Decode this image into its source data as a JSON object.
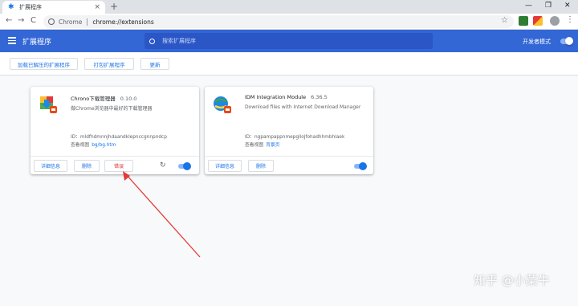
{
  "browser": {
    "tab_title": "扩展程序",
    "tab_close": "×",
    "new_tab": "+",
    "window_controls": [
      "—",
      "❐",
      "✕"
    ],
    "nav": [
      "←",
      "→",
      "C"
    ],
    "url_scheme": "Chrome",
    "url": "chrome://extensions",
    "bookmark_icon": "star-icon",
    "menu": "⋮"
  },
  "header": {
    "title": "扩展程序",
    "search_placeholder": "搜索扩展程序",
    "dev_mode_label": "开发者模式",
    "dev_mode_on": true
  },
  "actions": {
    "load_unpacked": "加载已解压的扩展程序",
    "pack": "打包扩展程序",
    "update": "更新"
  },
  "extensions": [
    {
      "name": "Chrono下载管理器",
      "version": "0.10.0",
      "description": "做Chrome浏览器中最好的下载管理器",
      "id_line": "ID：mldfhdmnnjhdaandklepnccgnnpndcp",
      "view_label": "查看视图",
      "view_link": "bg/bg.htm",
      "details": "详细信息",
      "remove": "删除",
      "errors": "错误",
      "reload": "↻",
      "enabled": true
    },
    {
      "name": "IDM Integration Module",
      "version": "6.36.5",
      "description": "Download files with Internet Download Manager",
      "id_line": "ID：ngpampappnmepgilojfohadhhmbhlaek",
      "view_label": "查看视图",
      "view_link": "背景页",
      "details": "详细信息",
      "remove": "删除",
      "enabled": true
    }
  ],
  "watermark": "知乎 @小菜牛",
  "colors": {
    "header_blue": "#3367d6",
    "link_blue": "#1a73e8",
    "error_red": "#d93025",
    "annotation_arrow": "#e53935"
  }
}
